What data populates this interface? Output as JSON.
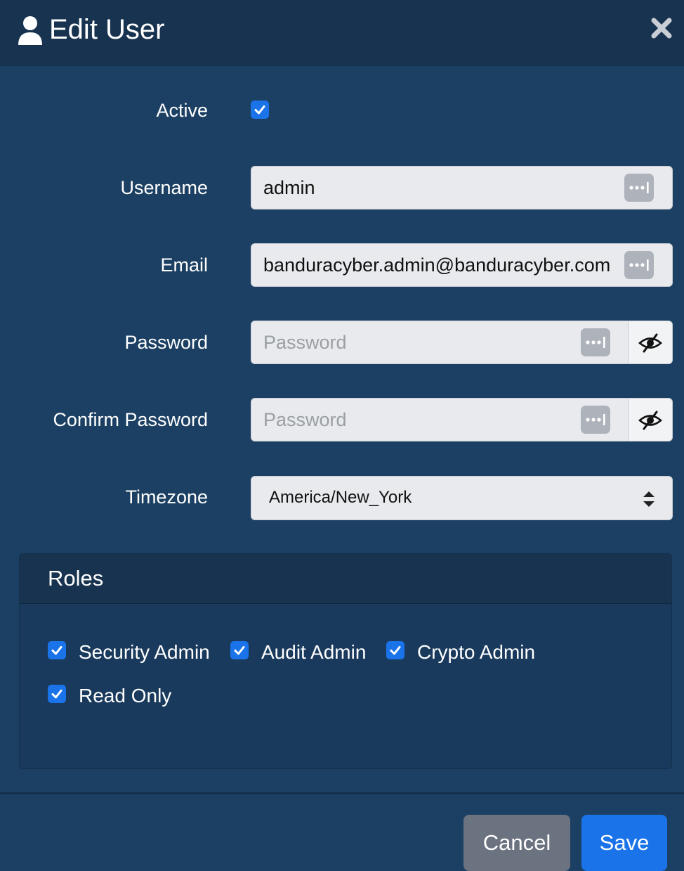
{
  "header": {
    "title": "Edit User",
    "icon": "user-icon",
    "close_icon": "close-icon"
  },
  "form": {
    "active": {
      "label": "Active",
      "checked": true
    },
    "username": {
      "label": "Username",
      "value": "admin"
    },
    "email": {
      "label": "Email",
      "value": "banduracyber.admin@banduracyber.com"
    },
    "password": {
      "label": "Password",
      "placeholder": "Password"
    },
    "confirm_password": {
      "label": "Confirm Password",
      "placeholder": "Password"
    },
    "timezone": {
      "label": "Timezone",
      "value": "America/New_York"
    }
  },
  "roles": {
    "title": "Roles",
    "items": [
      {
        "label": "Security Admin",
        "checked": true
      },
      {
        "label": "Audit Admin",
        "checked": true
      },
      {
        "label": "Crypto Admin",
        "checked": true
      },
      {
        "label": "Read Only",
        "checked": true
      }
    ]
  },
  "footer": {
    "cancel_label": "Cancel",
    "save_label": "Save"
  },
  "colors": {
    "header_bg": "#17334f",
    "body_bg": "#1c4063",
    "accent": "#1a73e8",
    "cancel_bg": "#6b7280"
  }
}
